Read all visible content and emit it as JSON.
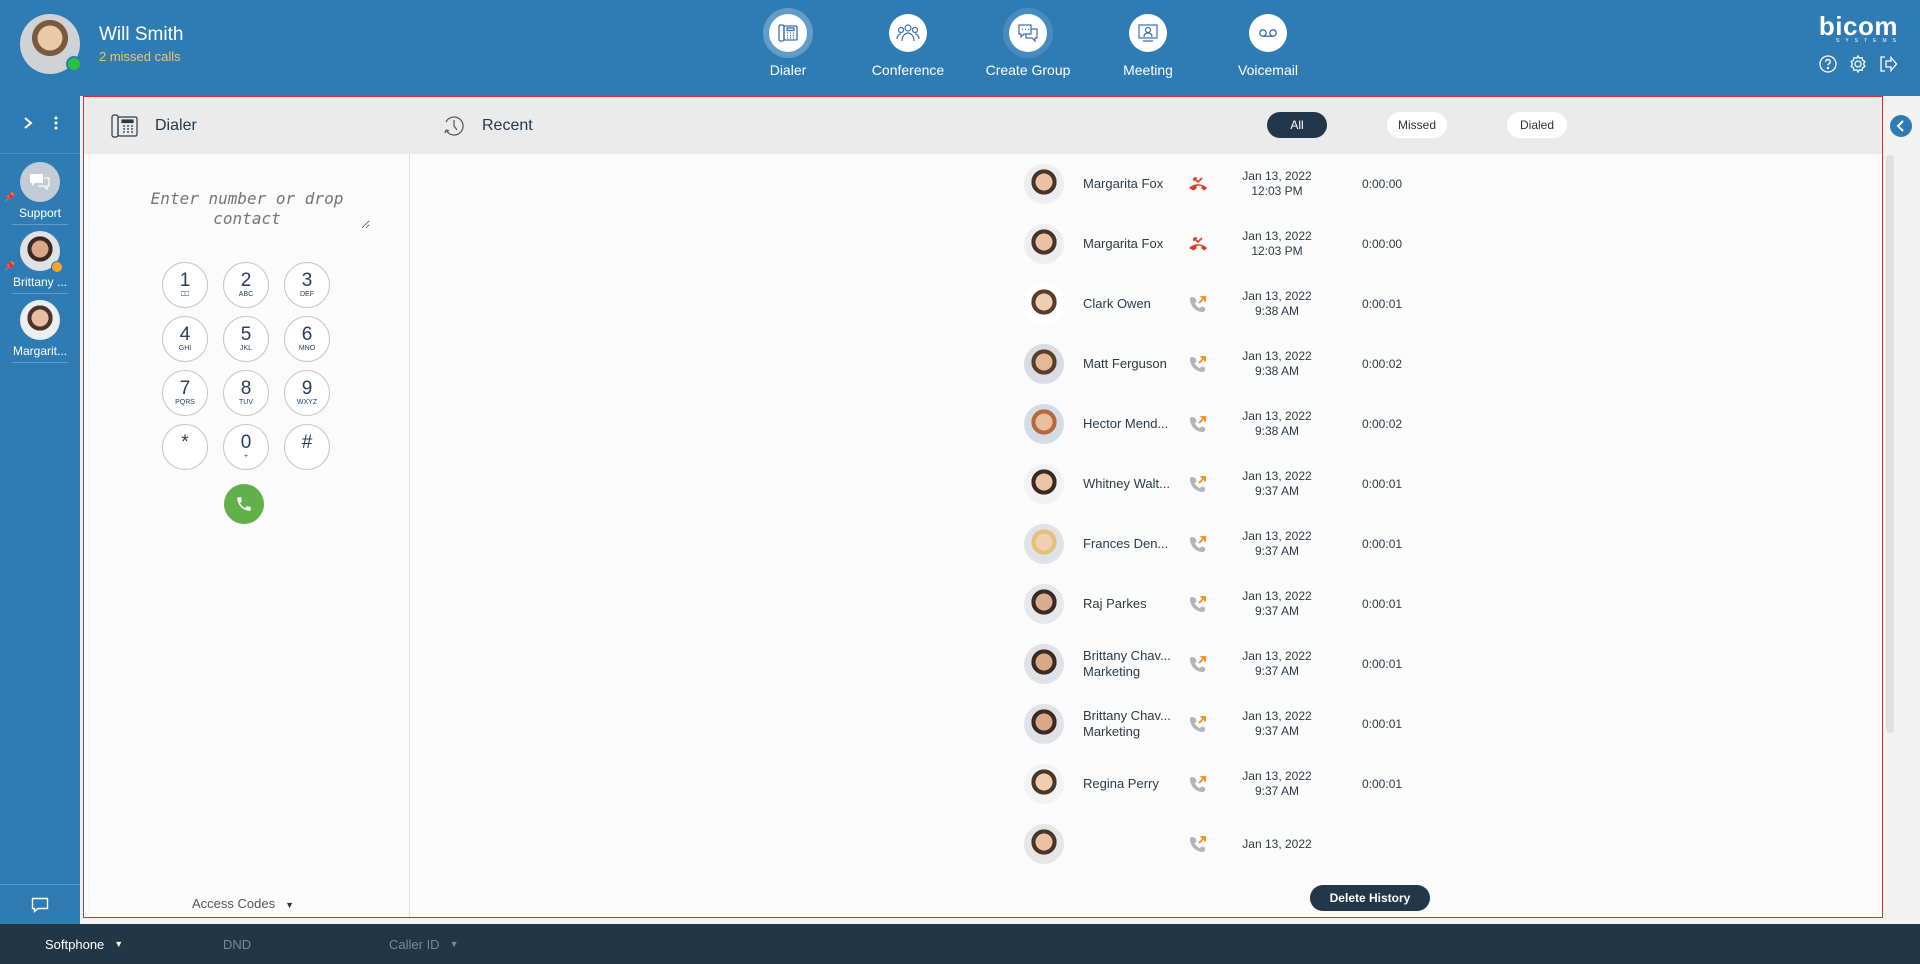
{
  "user": {
    "name": "Will Smith",
    "subtitle": "2 missed calls",
    "status": "online"
  },
  "nav": [
    {
      "label": "Dialer",
      "icon": "desk-phone-icon",
      "state": "active"
    },
    {
      "label": "Conference",
      "icon": "conference-icon",
      "state": ""
    },
    {
      "label": "Create Group",
      "icon": "chat-group-icon",
      "state": "hover"
    },
    {
      "label": "Meeting",
      "icon": "meeting-icon",
      "state": ""
    },
    {
      "label": "Voicemail",
      "icon": "voicemail-icon",
      "state": ""
    }
  ],
  "brand": {
    "logo": "bicom",
    "sub": "SYSTEMS"
  },
  "sidebar": {
    "contacts": [
      {
        "name": "Support",
        "type": "group",
        "pinned": true
      },
      {
        "name": "Brittany ...",
        "type": "person",
        "pinned": true,
        "status": "away"
      },
      {
        "name": "Margarit...",
        "type": "person",
        "pinned": false
      }
    ]
  },
  "dialer": {
    "title": "Dialer",
    "placeholder": "Enter number or drop contact",
    "keys": [
      {
        "digit": "1",
        "letters": "⎕⎕"
      },
      {
        "digit": "2",
        "letters": "ABC"
      },
      {
        "digit": "3",
        "letters": "DEF"
      },
      {
        "digit": "4",
        "letters": "GHI"
      },
      {
        "digit": "5",
        "letters": "JKL"
      },
      {
        "digit": "6",
        "letters": "MNO"
      },
      {
        "digit": "7",
        "letters": "PQRS"
      },
      {
        "digit": "8",
        "letters": "TUV"
      },
      {
        "digit": "9",
        "letters": "WXYZ"
      },
      {
        "digit": "*",
        "letters": ""
      },
      {
        "digit": "0",
        "letters": "+"
      },
      {
        "digit": "#",
        "letters": ""
      }
    ],
    "access_codes": "Access Codes"
  },
  "recent": {
    "title": "Recent",
    "filters": [
      {
        "label": "All",
        "active": true
      },
      {
        "label": "Missed",
        "active": false
      },
      {
        "label": "Dialed",
        "active": false
      }
    ],
    "calls": [
      {
        "name": "Margarita Fox",
        "sub": "",
        "type": "missed",
        "date": "Jan 13, 2022",
        "time": "12:03 PM",
        "duration": "0:00:00"
      },
      {
        "name": "Margarita Fox",
        "sub": "",
        "type": "missed",
        "date": "Jan 13, 2022",
        "time": "12:03 PM",
        "duration": "0:00:00"
      },
      {
        "name": "Clark Owen",
        "sub": "",
        "type": "outgoing",
        "date": "Jan 13, 2022",
        "time": "9:38 AM",
        "duration": "0:00:01"
      },
      {
        "name": "Matt Ferguson",
        "sub": "",
        "type": "outgoing",
        "date": "Jan 13, 2022",
        "time": "9:38 AM",
        "duration": "0:00:02"
      },
      {
        "name": "Hector Mend...",
        "sub": "",
        "type": "outgoing",
        "date": "Jan 13, 2022",
        "time": "9:38 AM",
        "duration": "0:00:02"
      },
      {
        "name": "Whitney Walt...",
        "sub": "",
        "type": "outgoing",
        "date": "Jan 13, 2022",
        "time": "9:37 AM",
        "duration": "0:00:01"
      },
      {
        "name": "Frances Den...",
        "sub": "",
        "type": "outgoing",
        "date": "Jan 13, 2022",
        "time": "9:37 AM",
        "duration": "0:00:01"
      },
      {
        "name": "Raj Parkes",
        "sub": "",
        "type": "outgoing",
        "date": "Jan 13, 2022",
        "time": "9:37 AM",
        "duration": "0:00:01"
      },
      {
        "name": "Brittany Chav...",
        "sub": "Marketing",
        "type": "outgoing",
        "date": "Jan 13, 2022",
        "time": "9:37 AM",
        "duration": "0:00:01"
      },
      {
        "name": "Brittany Chav...",
        "sub": "Marketing",
        "type": "outgoing",
        "date": "Jan 13, 2022",
        "time": "9:37 AM",
        "duration": "0:00:01"
      },
      {
        "name": "Regina Perry",
        "sub": "",
        "type": "outgoing",
        "date": "Jan 13, 2022",
        "time": "9:37 AM",
        "duration": "0:00:01"
      },
      {
        "name": "",
        "sub": "",
        "type": "outgoing",
        "date": "Jan 13, 2022",
        "time": "",
        "duration": ""
      }
    ],
    "delete_label": "Delete History"
  },
  "statusbar": {
    "mode": "Softphone",
    "dnd": "DND",
    "caller_id": "Caller ID"
  },
  "colors": {
    "primary": "#2f7cb5",
    "dark": "#22374a",
    "missed": "#e03a1e",
    "outgoing": "#f08a1c",
    "call_green": "#62b04c",
    "warning": "#f2c36b"
  }
}
